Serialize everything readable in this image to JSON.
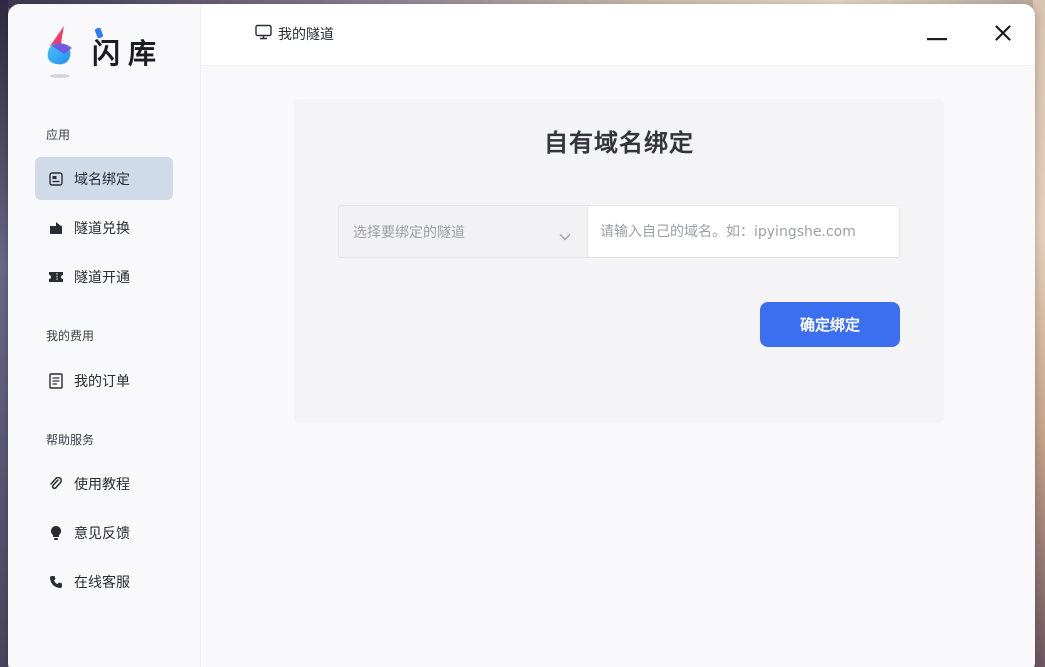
{
  "app": {
    "name": "闪库"
  },
  "sidebar": {
    "groups": [
      {
        "title": "应用",
        "items": [
          {
            "label": "域名绑定",
            "icon": "domain-card-icon",
            "active": true
          },
          {
            "label": "隧道兑换",
            "icon": "exchange-icon"
          },
          {
            "label": "隧道开通",
            "icon": "ticket-icon"
          }
        ]
      },
      {
        "title": "我的费用",
        "items": [
          {
            "label": "我的订单",
            "icon": "document-icon"
          }
        ]
      },
      {
        "title": "帮助服务",
        "items": [
          {
            "label": "使用教程",
            "icon": "paperclip-icon"
          },
          {
            "label": "意见反馈",
            "icon": "lightbulb-icon"
          },
          {
            "label": "在线客服",
            "icon": "phone-icon"
          }
        ]
      }
    ]
  },
  "header": {
    "tab_label": "我的隧道",
    "tab_icon": "monitor-icon"
  },
  "form": {
    "title": "自有域名绑定",
    "tunnel_select_placeholder": "选择要绑定的隧道",
    "domain_placeholder": "请输入自己的域名。如：ipyingshe.com",
    "domain_value": "",
    "submit_label": "确定绑定"
  },
  "colors": {
    "primary": "#3c6ff0",
    "active_nav_bg": "#cfdbe9"
  }
}
